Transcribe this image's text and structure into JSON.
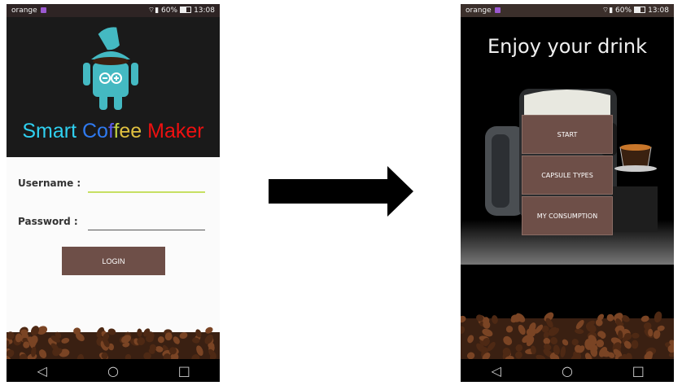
{
  "left_screen": {
    "status": {
      "carrier": "orange",
      "battery": "60%",
      "time": "13:08"
    },
    "app_title_parts": [
      {
        "text": "Smart ",
        "color": "#2fd0f0"
      },
      {
        "text": "Co",
        "color": "#2f7af0"
      },
      {
        "text": "f",
        "color": "#5a5af0"
      },
      {
        "text": "f",
        "color": "#c0d040"
      },
      {
        "text": "ee ",
        "color": "#e0c040"
      },
      {
        "text": "Maker",
        "color": "#ee1010"
      }
    ],
    "form": {
      "username_label": "Username :",
      "password_label": "Password :",
      "login_label": "LOGIN"
    }
  },
  "right_screen": {
    "status": {
      "carrier": "orange",
      "battery": "60%",
      "time": "13:08"
    },
    "title": "Enjoy your drink",
    "menu": [
      "START",
      "CAPSULE TYPES",
      "MY CONSUMPTION"
    ]
  },
  "colors": {
    "accent_brown": "#6e4f48",
    "input_highlight": "#c7e063"
  }
}
